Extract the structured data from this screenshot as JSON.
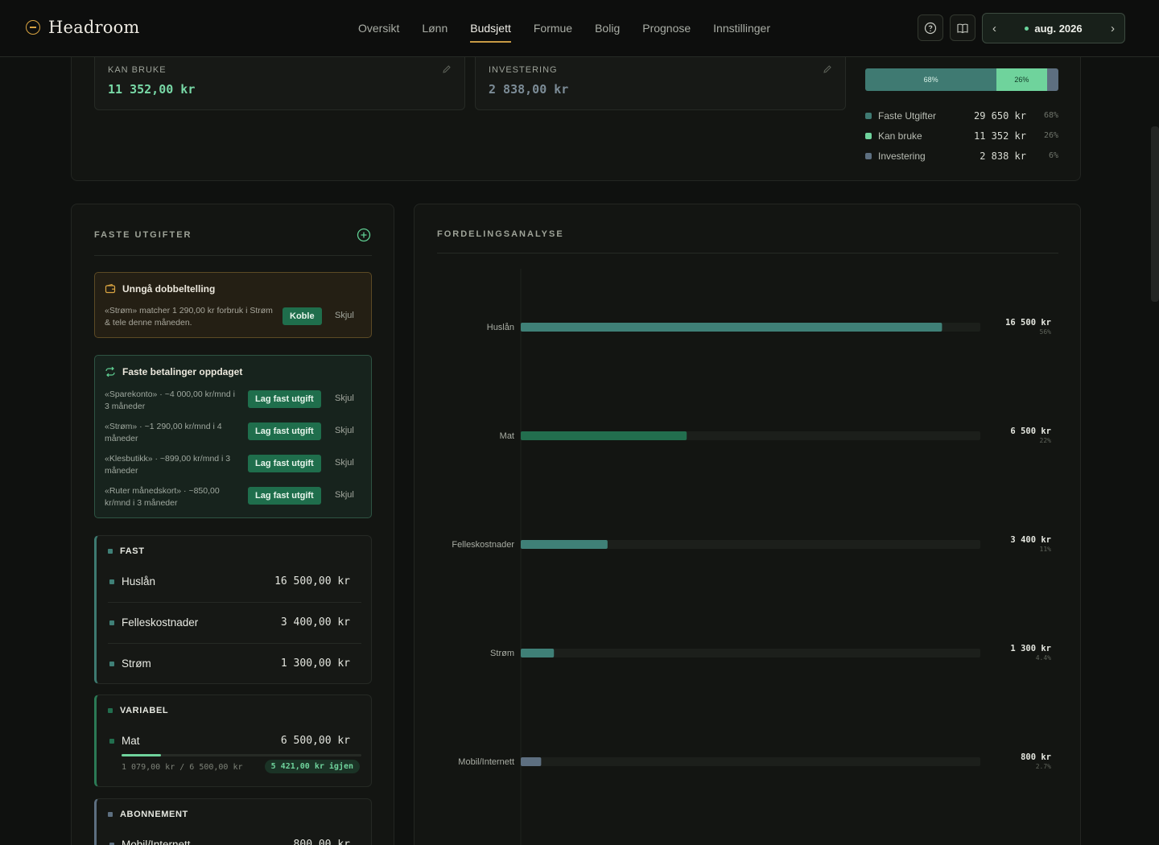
{
  "app": {
    "name": "Headroom"
  },
  "nav": [
    {
      "label": "Oversikt"
    },
    {
      "label": "Lønn"
    },
    {
      "label": "Budsjett",
      "active": true
    },
    {
      "label": "Formue"
    },
    {
      "label": "Bolig"
    },
    {
      "label": "Prognose"
    },
    {
      "label": "Innstillinger"
    }
  ],
  "month": {
    "label": "aug. 2026"
  },
  "summary": {
    "kan_bruke": {
      "label": "KAN BRUKE",
      "value": "11 352,00 kr"
    },
    "investering": {
      "label": "INVESTERING",
      "value": "2 838,00 kr"
    },
    "distribution": [
      {
        "name": "Faste Utgifter",
        "amount": "29 650 kr",
        "pct": "68%",
        "bar_label": "68%",
        "share": 0.68,
        "color": "#3f7a72"
      },
      {
        "name": "Kan bruke",
        "amount": "11 352 kr",
        "pct": "26%",
        "bar_label": "26%",
        "share": 0.26,
        "color": "#6fd39c"
      },
      {
        "name": "Investering",
        "amount": "2 838 kr",
        "pct": "6%",
        "bar_label": "",
        "share": 0.06,
        "color": "#5d6f80"
      }
    ]
  },
  "faste": {
    "title": "FASTE UTGIFTER",
    "warning": {
      "title": "Unngå dobbeltelling",
      "text": "«Strøm» matcher 1 290,00 kr forbruk i Strøm & tele denne måneden.",
      "connect_label": "Koble",
      "hide_label": "Skjul"
    },
    "detected": {
      "title": "Faste betalinger oppdaget",
      "action_label": "Lag fast utgift",
      "hide_label": "Skjul",
      "items": [
        {
          "text": "«Sparekonto» · ~4 000,00 kr/mnd i 3 måneder"
        },
        {
          "text": "«Strøm» · ~1 290,00 kr/mnd i 4 måneder"
        },
        {
          "text": "«Klesbutikk» · ~899,00 kr/mnd i 3 måneder"
        },
        {
          "text": "«Ruter månedskort» · ~850,00 kr/mnd i 3 måneder"
        }
      ]
    },
    "groups": {
      "fast": {
        "label": "FAST",
        "items": [
          {
            "name": "Huslån",
            "amount": "16 500,00 kr"
          },
          {
            "name": "Felleskostnader",
            "amount": "3 400,00 kr"
          },
          {
            "name": "Strøm",
            "amount": "1 300,00 kr"
          }
        ]
      },
      "variabel": {
        "label": "VARIABEL",
        "items": [
          {
            "name": "Mat",
            "amount": "6 500,00 kr",
            "spent": "1 079,00 kr / 6 500,00 kr",
            "remaining": "5 421,00 kr igjen",
            "progress": 0.166
          }
        ]
      },
      "abonnement": {
        "label": "ABONNEMENT",
        "items": [
          {
            "name": "Mobil/Internett",
            "amount": "800,00 kr"
          }
        ]
      }
    }
  },
  "analysis": {
    "title": "FORDELINGSANALYSE"
  },
  "chart_data": {
    "type": "bar",
    "orientation": "horizontal",
    "categories": [
      "Huslån",
      "Mat",
      "Felleskostnader",
      "Strøm",
      "Mobil/Internett"
    ],
    "values": [
      16500,
      6500,
      3400,
      1300,
      800
    ],
    "value_labels": [
      "16 500 kr",
      "6 500 kr",
      "3 400 kr",
      "1 300 kr",
      "800 kr"
    ],
    "pct_labels": [
      "56%",
      "22%",
      "11%",
      "4.4%",
      "2.7%"
    ],
    "colors": [
      "#3f8077",
      "#226e4e",
      "#3f8077",
      "#3f8077",
      "#5d6f80"
    ],
    "xlim": [
      0,
      18000
    ],
    "grid": false
  }
}
